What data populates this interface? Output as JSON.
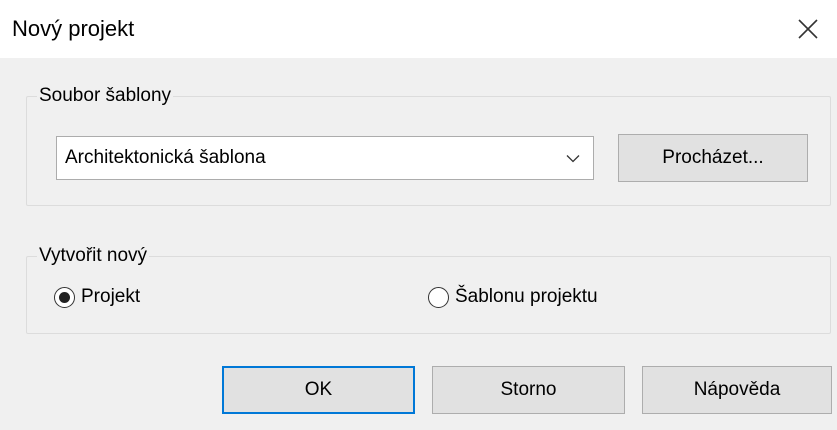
{
  "window": {
    "title": "Nový projekt",
    "close_icon": "close-icon"
  },
  "template_group": {
    "label": "Soubor šablony",
    "template_select": {
      "selected_value": "Architektonická šablona",
      "dropdown_icon": "chevron-down-icon"
    },
    "browse_label": "Procházet..."
  },
  "create_group": {
    "label": "Vytvořit nový",
    "options": [
      {
        "label": "Projekt",
        "selected": true
      },
      {
        "label": "Šablonu projektu",
        "selected": false
      }
    ]
  },
  "buttons": {
    "ok_label": "OK",
    "cancel_label": "Storno",
    "help_label": "Nápověda"
  },
  "colors": {
    "default_button_border": "#0078d7",
    "dialog_background": "#f0f0f0"
  }
}
